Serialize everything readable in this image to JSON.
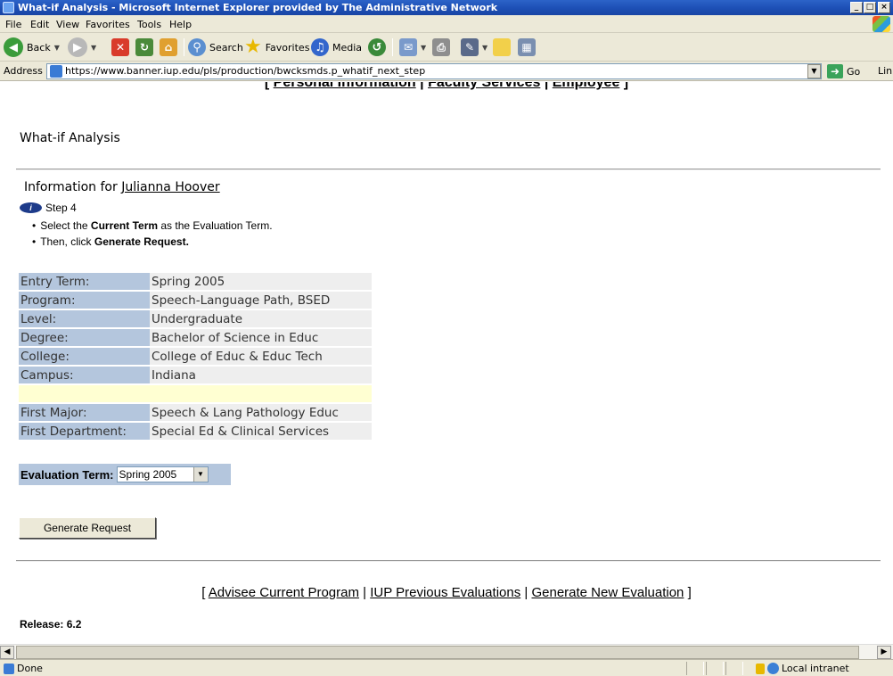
{
  "window": {
    "title": "What-if Analysis - Microsoft Internet Explorer provided by The Administrative Network",
    "controls": [
      "_",
      "□",
      "×"
    ]
  },
  "menu": [
    "File",
    "Edit",
    "View",
    "Favorites",
    "Tools",
    "Help"
  ],
  "toolbar": {
    "back_label": "Back",
    "search_label": "Search",
    "favorites_label": "Favorites",
    "media_label": "Media"
  },
  "address": {
    "label": "Address",
    "url": "https://www.banner.iup.edu/pls/production/bwcksmds.p_whatif_next_step",
    "go_label": "Go",
    "links_label": "Links"
  },
  "top_nav": {
    "open": "[",
    "items": [
      "Personal Information",
      "Faculty Services",
      "Employee"
    ],
    "sep": "|",
    "close": "]"
  },
  "page": {
    "title": "What-if Analysis",
    "info_prefix": "Information for",
    "student_name": "Julianna Hoover",
    "step_label": "Step 4",
    "instruction1": {
      "pre": "Select the ",
      "bold": "Current Term",
      "post": " as the Evaluation Term."
    },
    "instruction2": {
      "pre": "Then, click ",
      "bold": "Generate Request."
    }
  },
  "details": [
    {
      "label": "Entry Term:",
      "value": "Spring 2005"
    },
    {
      "label": "Program:",
      "value": "Speech-Language Path, BSED"
    },
    {
      "label": "Level:",
      "value": "Undergraduate"
    },
    {
      "label": "Degree:",
      "value": "Bachelor of Science in Educ"
    },
    {
      "label": "College:",
      "value": "College of Educ & Educ Tech"
    },
    {
      "label": "Campus:",
      "value": "Indiana"
    },
    {
      "label": "First Major:",
      "value": "Speech & Lang Pathology Educ"
    },
    {
      "label": "First Department:",
      "value": "Special Ed & Clinical Services"
    }
  ],
  "evaluation": {
    "label": "Evaluation Term:",
    "selected": "Spring 2005"
  },
  "generate_button": "Generate Request",
  "bottom_nav": {
    "open": "[",
    "items": [
      "Advisee Current Program",
      "IUP Previous Evaluations",
      "Generate New Evaluation"
    ],
    "sep": "|",
    "close": "]"
  },
  "release": "Release: 6.2",
  "status": {
    "done": "Done",
    "zone": "Local intranet"
  }
}
